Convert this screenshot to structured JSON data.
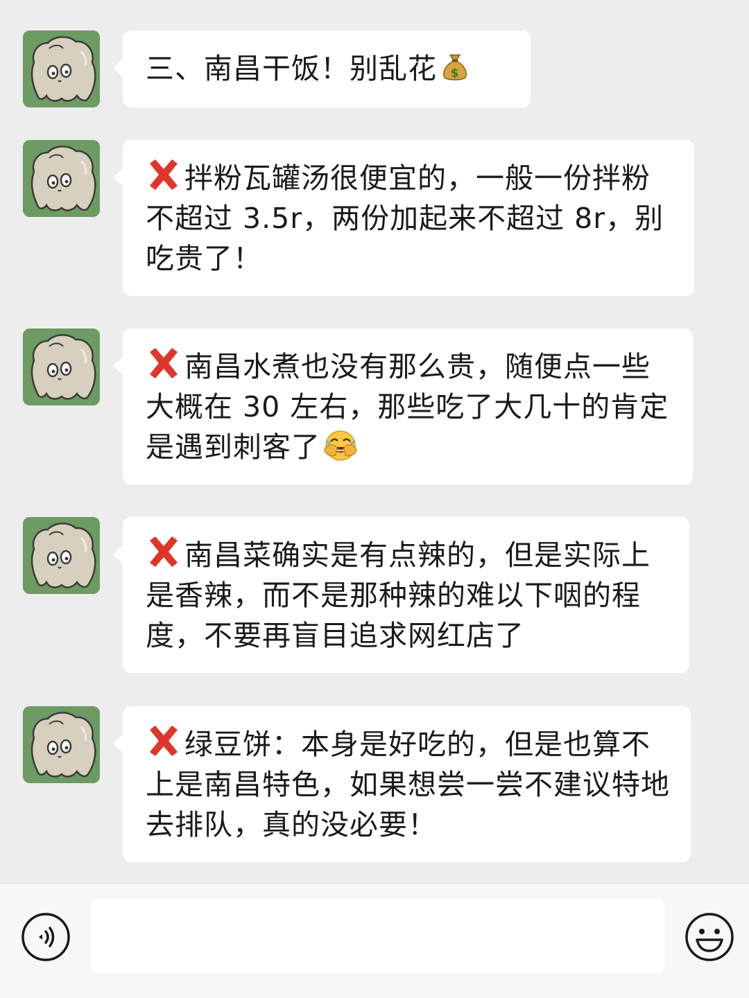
{
  "messages": [
    {
      "prefix_icon": "",
      "text": "三、南昌干饭！别乱花",
      "suffix_icon": "money-bag-icon"
    },
    {
      "prefix_icon": "red-x-icon",
      "text": "拌粉瓦罐汤很便宜的，一般一份拌粉不超过 3.5r，两份加起来不超过 8r，别吃贵了！",
      "suffix_icon": ""
    },
    {
      "prefix_icon": "red-x-icon",
      "text": "南昌水煮也没有那么贵，随便点一些大概在 30 左右，那些吃了大几十的肯定是遇到刺客了",
      "suffix_icon": "crying-laughing-face-icon"
    },
    {
      "prefix_icon": "red-x-icon",
      "text": "南昌菜确实是有点辣的，但是实际上是香辣，而不是那种辣的难以下咽的程度，不要再盲目追求网红店了",
      "suffix_icon": ""
    },
    {
      "prefix_icon": "red-x-icon",
      "text": "绿豆饼：本身是好吃的，但是也算不上是南昌特色，如果想尝一尝不建议特地去排队，真的没必要！",
      "suffix_icon": ""
    }
  ],
  "input_bar": {
    "voice_icon": "voice-input-icon",
    "text_value": "",
    "emoji_icon": "smiley-face-icon"
  },
  "colors": {
    "background": "#ededed",
    "bubble": "#ffffff",
    "avatar_bg": "#6e9a63",
    "x_mark": "#e0352b"
  }
}
